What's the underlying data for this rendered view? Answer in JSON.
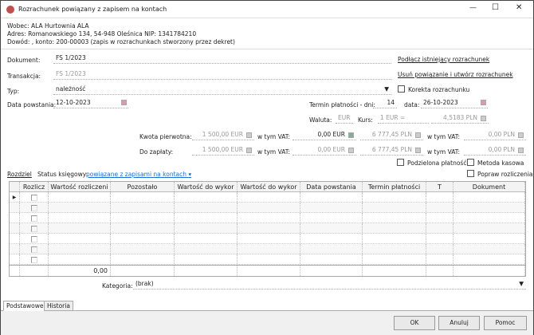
{
  "window": {
    "title": "Rozrachunek powiązany z zapisem na kontach",
    "minimize": "—",
    "maximize": "☐",
    "close": "✕"
  },
  "info": {
    "wobec": "Wobec: ALA Hurtownia ALA",
    "adres": "Adres: Romanowskiego 134, 54-948 Oleśnica NIP: 1341784210",
    "dowod": "Dowód: , konto: 200-00003 (zapis w rozrachunkach stworzony przez dekret)"
  },
  "form": {
    "dokument_label": "Dokument:",
    "dokument": "FS 1/2023",
    "transakcja_label": "Transakcja:",
    "transakcja": "FS 1/2023",
    "typ_label": "Typ:",
    "typ": "należność",
    "data_label": "Data powstania:",
    "data": "12-10-2023",
    "link_podlacz": "Podłącz istniejący rozrachunek",
    "link_usun": "Usuń powiązanie i utwórz rozrachunek",
    "korekta": "Korekta rozrachunku",
    "termin_label": "Termin płatności - dni:",
    "termin_dni": "14",
    "data2_label": "data:",
    "data2": "26-10-2023",
    "waluta_label": "Waluta:",
    "waluta": "EUR",
    "kurs_label": "Kurs:",
    "kurs_base": "1 EUR =",
    "kurs": "4,5183 PLN",
    "kwota_label": "Kwota pierwotna:",
    "kwota": "1 500,00 EUR",
    "vat_label": "w tym VAT:",
    "kwota_vat": "0,00 EUR",
    "kwota_pln": "6 777,45 PLN",
    "kwota_vat_pln": "0,00 PLN",
    "zaplata_label": "Do zapłaty:",
    "zaplata": "1 500,00 EUR",
    "zaplata_vat": "0,00 EUR",
    "zaplata_pln": "6 777,45 PLN",
    "zaplata_vat_pln": "0,00 PLN",
    "podzielona": "Podzielona płatność",
    "metoda": "Metoda kasowa",
    "popraw": "Popraw rozliczenia",
    "rozdziel": "Rozdziel",
    "status_label": "Status księgowy:",
    "status": "powiązane z zapisami na kontach"
  },
  "grid": {
    "columns": [
      "Rozlicz",
      "Wartość rozliczeni",
      "Pozostało",
      "Wartość do wykor",
      "Wartość do wykor",
      "Data powstania",
      "Termin płatności",
      "T",
      "Dokument"
    ],
    "total": "0,00"
  },
  "kategoria": {
    "label": "Kategoria:",
    "value": "(brak)"
  },
  "tabs": [
    "Podstawowe",
    "Historia"
  ],
  "buttons": {
    "ok": "OK",
    "cancel": "Anuluj",
    "help": "Pomoc"
  }
}
